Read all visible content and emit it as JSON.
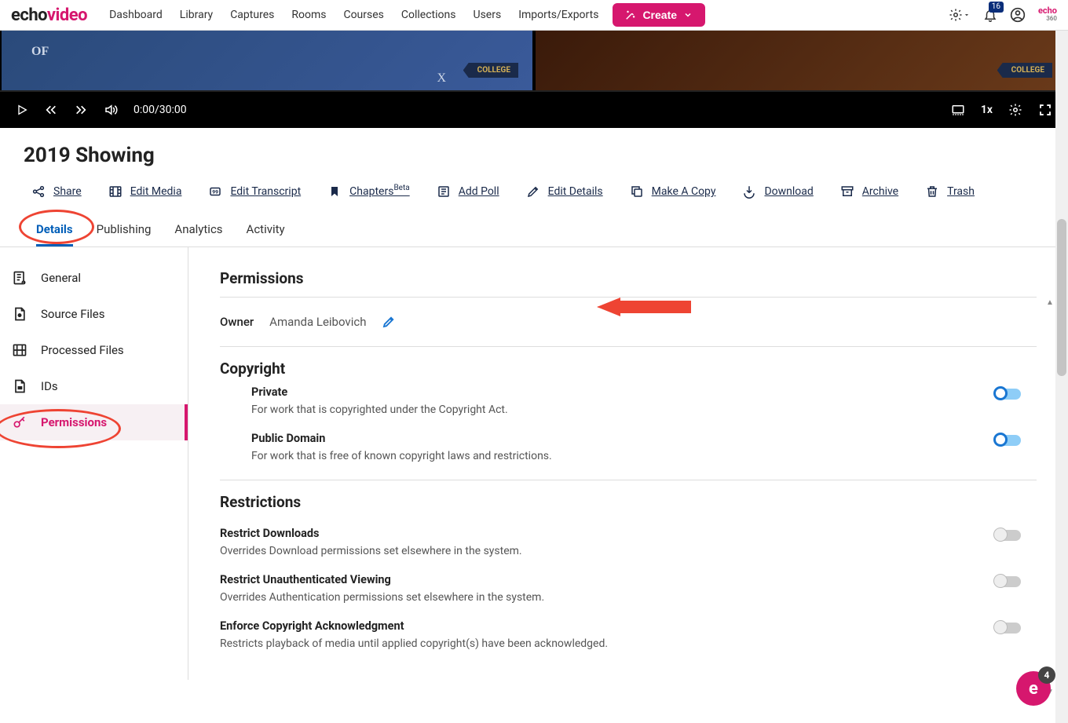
{
  "brand": {
    "part1": "echo",
    "part2": "video"
  },
  "nav": {
    "dashboard": "Dashboard",
    "library": "Library",
    "captures": "Captures",
    "rooms": "Rooms",
    "courses": "Courses",
    "collections": "Collections",
    "users": "Users",
    "imports": "Imports/Exports"
  },
  "create_btn": "Create",
  "notif_badge": "16",
  "echo360": {
    "top": "echo",
    "bottom": "360"
  },
  "video": {
    "time": "0:00/30:00",
    "speed": "1x",
    "college_badge": "COLLEGE",
    "of_text": "OF",
    "x_text": "X"
  },
  "media_title": "2019 Showing",
  "actions": {
    "share": "Share",
    "edit_media": "Edit Media",
    "edit_transcript": "Edit Transcript",
    "chapters": "Chapters",
    "chapters_beta": "Beta",
    "add_poll": "Add Poll",
    "edit_details": "Edit Details",
    "make_copy": "Make A Copy",
    "download": "Download",
    "archive": "Archive",
    "trash": "Trash"
  },
  "tabs": {
    "details": "Details",
    "publishing": "Publishing",
    "analytics": "Analytics",
    "activity": "Activity"
  },
  "sidebar": {
    "general": "General",
    "source_files": "Source Files",
    "processed_files": "Processed Files",
    "ids": "IDs",
    "permissions": "Permissions"
  },
  "permissions": {
    "heading": "Permissions",
    "owner_label": "Owner",
    "owner_name": "Amanda Leibovich"
  },
  "copyright": {
    "heading": "Copyright",
    "private_title": "Private",
    "private_desc": "For work that is copyrighted under the Copyright Act.",
    "public_title": "Public Domain",
    "public_desc": "For work that is free of known copyright laws and restrictions."
  },
  "restrictions": {
    "heading": "Restrictions",
    "r1_title": "Restrict Downloads",
    "r1_desc": "Overrides Download permissions set elsewhere in the system.",
    "r2_title": "Restrict Unauthenticated Viewing",
    "r2_desc": "Overrides Authentication permissions set elsewhere in the system.",
    "r3_title": "Enforce Copyright Acknowledgment",
    "r3_desc": "Restricts playback of media until applied copyright(s) have been acknowledged."
  },
  "chat_badge": "4"
}
